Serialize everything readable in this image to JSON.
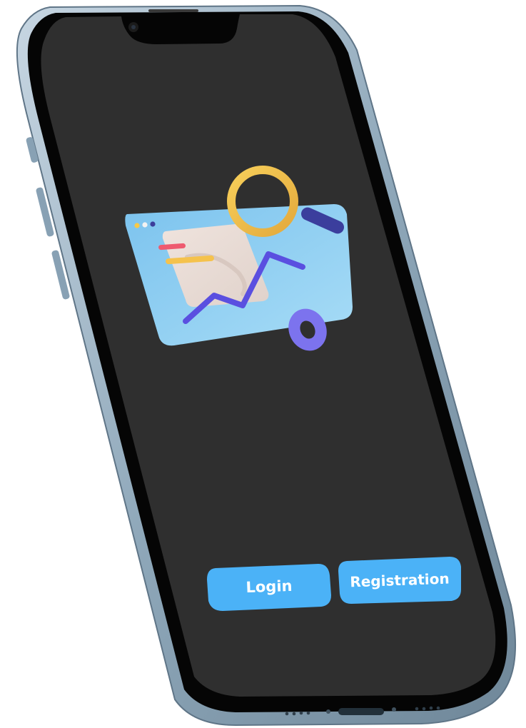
{
  "app": {
    "buttons": {
      "login_label": "Login",
      "registration_label": "Registration"
    },
    "illustration": {
      "icons": [
        "browser-window-icon",
        "magnifier-icon",
        "line-chart-icon",
        "torus-icon"
      ]
    }
  },
  "colors": {
    "screen_background": "#2f2f2f",
    "button_background": "#4bb2f7",
    "button_text": "#ffffff",
    "phone_frame": "#9fb7c8"
  }
}
